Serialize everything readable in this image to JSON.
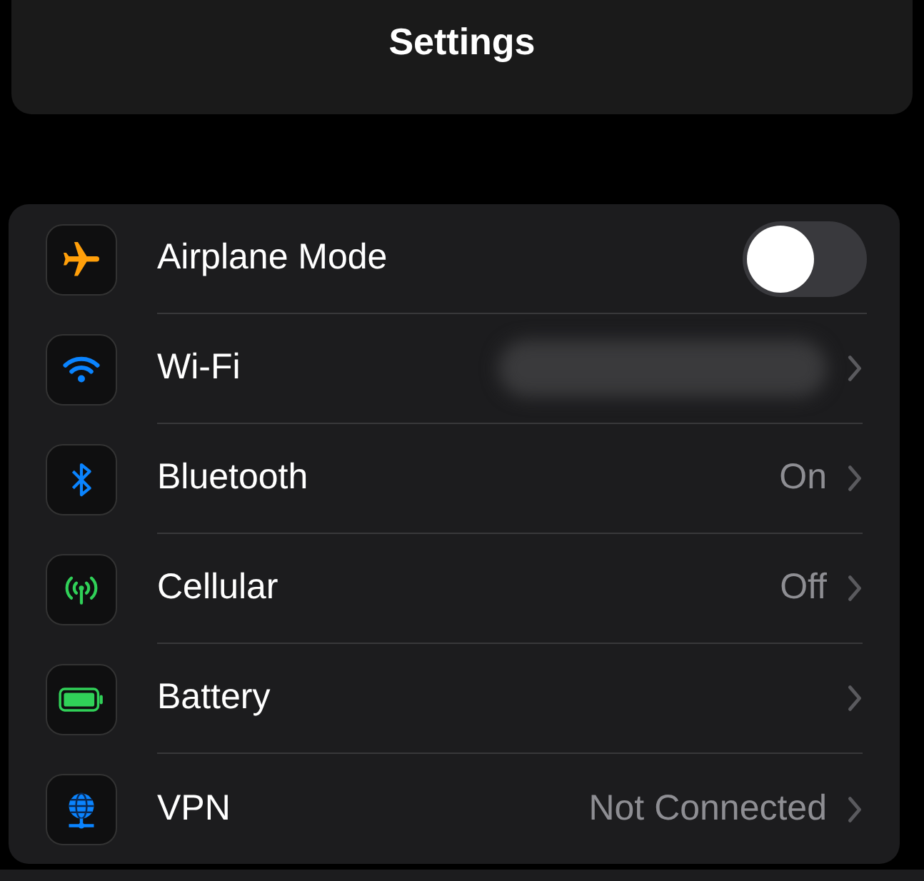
{
  "title": "Settings",
  "rows": [
    {
      "kind": "toggle",
      "label": "Airplane Mode",
      "on": false
    },
    {
      "kind": "link",
      "label": "Wi-Fi",
      "redacted": true
    },
    {
      "kind": "link",
      "label": "Bluetooth",
      "value": "On"
    },
    {
      "kind": "link",
      "label": "Cellular",
      "value": "Off"
    },
    {
      "kind": "link",
      "label": "Battery"
    },
    {
      "kind": "link",
      "label": "VPN",
      "value": "Not Connected"
    }
  ]
}
